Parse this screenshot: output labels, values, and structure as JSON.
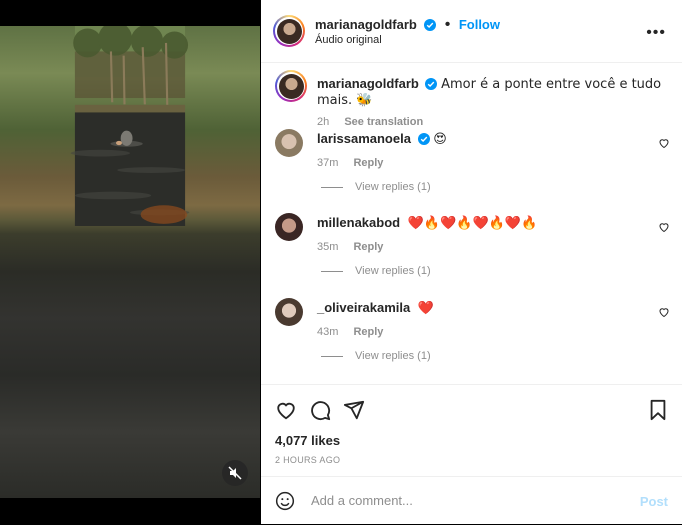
{
  "post": {
    "author": "marianagoldfarb",
    "follow_label": "Follow",
    "audio": "Áudio original",
    "more_label": "•••",
    "caption_text": "Amor é a ponte entre você e tudo mais. 🐝",
    "caption_time": "2h",
    "see_translation": "See translation"
  },
  "comments": [
    {
      "user": "larissamanoela",
      "verified": true,
      "text": "😍",
      "time": "37m",
      "reply": "Reply",
      "view_replies": "View replies (1)"
    },
    {
      "user": "millenakabod",
      "verified": false,
      "text": "❤️🔥❤️🔥❤️🔥❤️🔥",
      "time": "35m",
      "reply": "Reply",
      "view_replies": "View replies (1)"
    },
    {
      "user": "_oliveirakamila",
      "verified": false,
      "text": "❤️",
      "time": "43m",
      "reply": "Reply",
      "view_replies": "View replies (1)"
    }
  ],
  "stats": {
    "likes": "4,077 likes",
    "time_ago": "2 HOURS AGO"
  },
  "add_comment": {
    "placeholder": "Add a comment...",
    "post_label": "Post"
  },
  "colors": {
    "accent": "#0095f6",
    "post_disabled": "#b2dffc",
    "muted": "#8e8e8e"
  }
}
